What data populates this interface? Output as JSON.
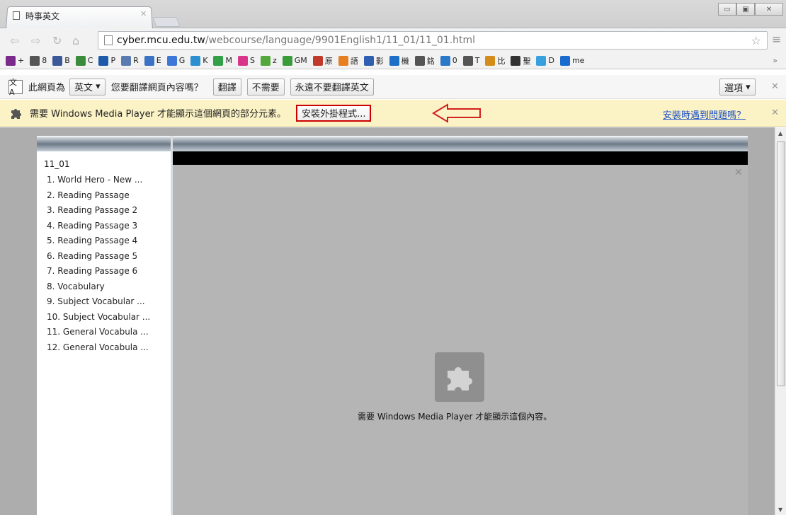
{
  "browser": {
    "tab_title": "時事英文",
    "url_host": "cyber.mcu.edu.tw",
    "url_path": "/webcourse/language/9901English1/11_01/11_01.html"
  },
  "bookmarks": [
    {
      "icon": "purple-glasses",
      "label": "+",
      "color": "#7a2a8a"
    },
    {
      "icon": "page",
      "label": "8",
      "color": "#555"
    },
    {
      "icon": "facebook",
      "label": "B",
      "color": "#3b5998"
    },
    {
      "icon": "green-shape",
      "label": "C",
      "color": "#3a8b3a"
    },
    {
      "icon": "outlook",
      "label": "P",
      "color": "#1d5aa8"
    },
    {
      "icon": "rss-r",
      "label": "R",
      "color": "#5a7bb0"
    },
    {
      "icon": "blue-e",
      "label": "E",
      "color": "#3b73c4"
    },
    {
      "icon": "blue-g",
      "label": "G",
      "color": "#3d78d8"
    },
    {
      "icon": "blue-k",
      "label": "K",
      "color": "#2c8fd0"
    },
    {
      "icon": "green-m",
      "label": "M",
      "color": "#31a047"
    },
    {
      "icon": "pink-s",
      "label": "S",
      "color": "#d9368b"
    },
    {
      "icon": "green-z",
      "label": "z",
      "color": "#52a83a"
    },
    {
      "icon": "play-gm",
      "label": "GM",
      "color": "#3a9b3a"
    },
    {
      "icon": "red-box",
      "label": "原",
      "color": "#c0392b"
    },
    {
      "icon": "orange-diamond",
      "label": "語",
      "color": "#e67e22"
    },
    {
      "icon": "blue-box",
      "label": "影",
      "color": "#2e5fb0"
    },
    {
      "icon": "blue-s",
      "label": "機",
      "color": "#1e6fc8"
    },
    {
      "icon": "page",
      "label": "銘",
      "color": "#555"
    },
    {
      "icon": "blue-b",
      "label": "0",
      "color": "#2a78c8"
    },
    {
      "icon": "page",
      "label": "T",
      "color": "#555"
    },
    {
      "icon": "orange-bird",
      "label": "比",
      "color": "#d48d1a"
    },
    {
      "icon": "black-dot",
      "label": "聖",
      "color": "#333"
    },
    {
      "icon": "blue-square",
      "label": "D",
      "color": "#39a0e0"
    },
    {
      "icon": "ie-e",
      "label": "me",
      "color": "#1c6cd0"
    }
  ],
  "translate_bar": {
    "prefix": "此網頁為",
    "language": "英文",
    "question": "您要翻譯網頁內容嗎？",
    "translate": "翻譯",
    "no": "不需要",
    "never": "永遠不要翻譯英文",
    "options": "選項"
  },
  "plugin_bar": {
    "message": "需要 Windows Media Player 才能顯示這個網頁的部分元素。",
    "install": "安裝外掛程式...",
    "help": "安裝時遇到問題嗎？"
  },
  "lesson": {
    "title": "11_01",
    "items": [
      "1. World Hero - New ...",
      "2. Reading Passage",
      "3. Reading Passage 2",
      "4. Reading Passage 3",
      "5. Reading Passage 4",
      "6. Reading Passage 5",
      "7. Reading Passage 6",
      "8. Vocabulary",
      "9. Subject Vocabular ...",
      "10. Subject Vocabular ...",
      "11. General Vocabula ...",
      "12. General Vocabula ..."
    ]
  },
  "player": {
    "message": "需要 Windows Media Player 才能顯示這個內容。"
  },
  "colors": {
    "infobar": "#fbf2c5",
    "link": "#1a4fc9",
    "highlight": "#cc0000",
    "page_bg": "#adadad"
  }
}
